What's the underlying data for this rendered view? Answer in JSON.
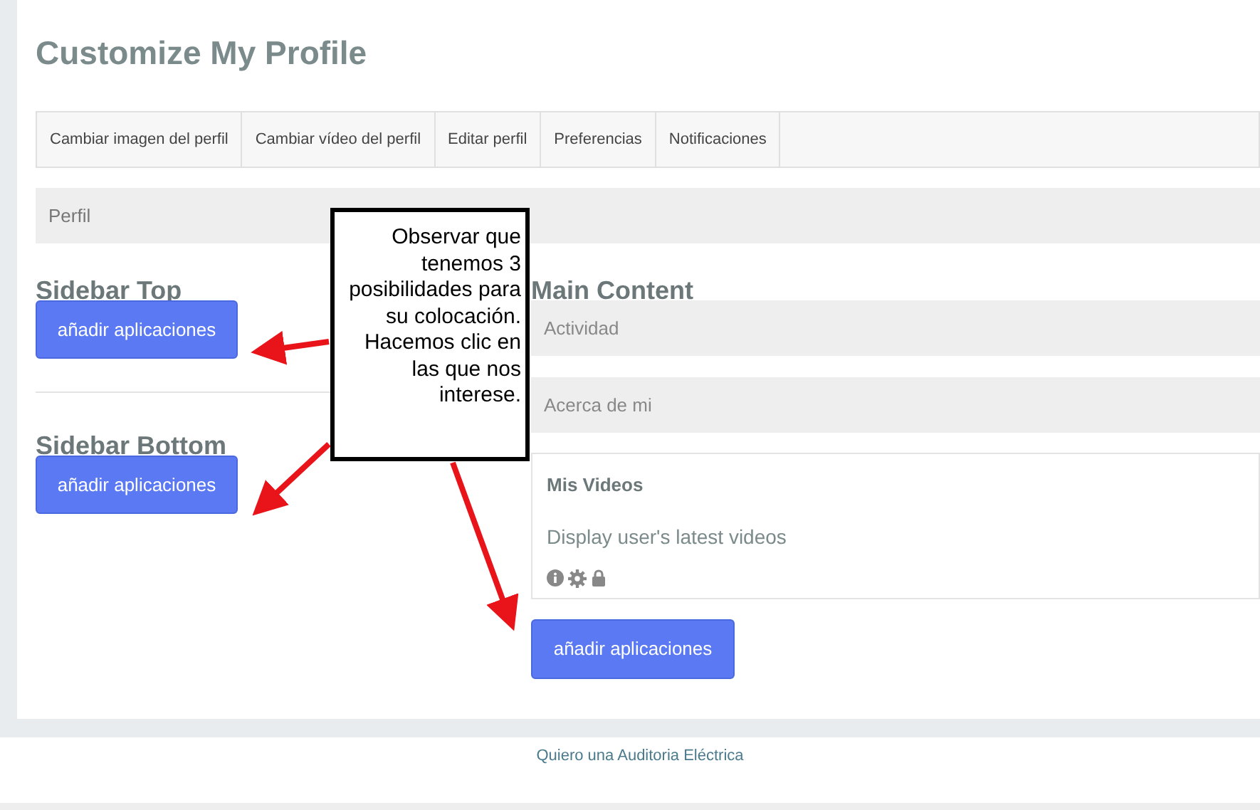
{
  "title": "Customize My Profile",
  "tabs": [
    "Cambiar imagen del perfil",
    "Cambiar vídeo del perfil",
    "Editar perfil",
    "Preferencias",
    "Notificaciones"
  ],
  "section_bar": "Perfil",
  "sidebar_top": {
    "heading": "Sidebar Top",
    "button": "añadir aplicaciones"
  },
  "sidebar_bottom": {
    "heading": "Sidebar Bottom",
    "button": "añadir aplicaciones"
  },
  "main_content": {
    "heading": "Main Content",
    "bars": [
      "Actividad",
      "Acerca de mi"
    ],
    "widget": {
      "title": "Mis Videos",
      "description": "Display user's latest videos"
    },
    "button": "añadir aplicaciones"
  },
  "callout": "Observar que tenemos 3 posibilidades para su colocación. Hacemos clic en las que nos interese.",
  "footer_link": "Quiero una Auditoria Eléctrica"
}
